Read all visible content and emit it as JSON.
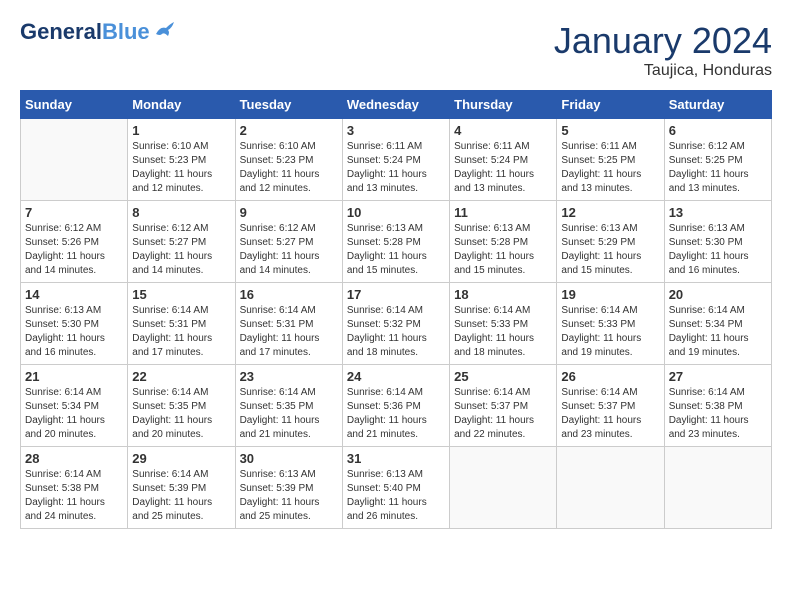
{
  "header": {
    "logo_general": "General",
    "logo_blue": "Blue",
    "month": "January 2024",
    "location": "Taujica, Honduras"
  },
  "days_of_week": [
    "Sunday",
    "Monday",
    "Tuesday",
    "Wednesday",
    "Thursday",
    "Friday",
    "Saturday"
  ],
  "weeks": [
    [
      {
        "day": "",
        "info": ""
      },
      {
        "day": "1",
        "info": "Sunrise: 6:10 AM\nSunset: 5:23 PM\nDaylight: 11 hours\nand 12 minutes."
      },
      {
        "day": "2",
        "info": "Sunrise: 6:10 AM\nSunset: 5:23 PM\nDaylight: 11 hours\nand 12 minutes."
      },
      {
        "day": "3",
        "info": "Sunrise: 6:11 AM\nSunset: 5:24 PM\nDaylight: 11 hours\nand 13 minutes."
      },
      {
        "day": "4",
        "info": "Sunrise: 6:11 AM\nSunset: 5:24 PM\nDaylight: 11 hours\nand 13 minutes."
      },
      {
        "day": "5",
        "info": "Sunrise: 6:11 AM\nSunset: 5:25 PM\nDaylight: 11 hours\nand 13 minutes."
      },
      {
        "day": "6",
        "info": "Sunrise: 6:12 AM\nSunset: 5:25 PM\nDaylight: 11 hours\nand 13 minutes."
      }
    ],
    [
      {
        "day": "7",
        "info": "Sunrise: 6:12 AM\nSunset: 5:26 PM\nDaylight: 11 hours\nand 14 minutes."
      },
      {
        "day": "8",
        "info": "Sunrise: 6:12 AM\nSunset: 5:27 PM\nDaylight: 11 hours\nand 14 minutes."
      },
      {
        "day": "9",
        "info": "Sunrise: 6:12 AM\nSunset: 5:27 PM\nDaylight: 11 hours\nand 14 minutes."
      },
      {
        "day": "10",
        "info": "Sunrise: 6:13 AM\nSunset: 5:28 PM\nDaylight: 11 hours\nand 15 minutes."
      },
      {
        "day": "11",
        "info": "Sunrise: 6:13 AM\nSunset: 5:28 PM\nDaylight: 11 hours\nand 15 minutes."
      },
      {
        "day": "12",
        "info": "Sunrise: 6:13 AM\nSunset: 5:29 PM\nDaylight: 11 hours\nand 15 minutes."
      },
      {
        "day": "13",
        "info": "Sunrise: 6:13 AM\nSunset: 5:30 PM\nDaylight: 11 hours\nand 16 minutes."
      }
    ],
    [
      {
        "day": "14",
        "info": "Sunrise: 6:13 AM\nSunset: 5:30 PM\nDaylight: 11 hours\nand 16 minutes."
      },
      {
        "day": "15",
        "info": "Sunrise: 6:14 AM\nSunset: 5:31 PM\nDaylight: 11 hours\nand 17 minutes."
      },
      {
        "day": "16",
        "info": "Sunrise: 6:14 AM\nSunset: 5:31 PM\nDaylight: 11 hours\nand 17 minutes."
      },
      {
        "day": "17",
        "info": "Sunrise: 6:14 AM\nSunset: 5:32 PM\nDaylight: 11 hours\nand 18 minutes."
      },
      {
        "day": "18",
        "info": "Sunrise: 6:14 AM\nSunset: 5:33 PM\nDaylight: 11 hours\nand 18 minutes."
      },
      {
        "day": "19",
        "info": "Sunrise: 6:14 AM\nSunset: 5:33 PM\nDaylight: 11 hours\nand 19 minutes."
      },
      {
        "day": "20",
        "info": "Sunrise: 6:14 AM\nSunset: 5:34 PM\nDaylight: 11 hours\nand 19 minutes."
      }
    ],
    [
      {
        "day": "21",
        "info": "Sunrise: 6:14 AM\nSunset: 5:34 PM\nDaylight: 11 hours\nand 20 minutes."
      },
      {
        "day": "22",
        "info": "Sunrise: 6:14 AM\nSunset: 5:35 PM\nDaylight: 11 hours\nand 20 minutes."
      },
      {
        "day": "23",
        "info": "Sunrise: 6:14 AM\nSunset: 5:35 PM\nDaylight: 11 hours\nand 21 minutes."
      },
      {
        "day": "24",
        "info": "Sunrise: 6:14 AM\nSunset: 5:36 PM\nDaylight: 11 hours\nand 21 minutes."
      },
      {
        "day": "25",
        "info": "Sunrise: 6:14 AM\nSunset: 5:37 PM\nDaylight: 11 hours\nand 22 minutes."
      },
      {
        "day": "26",
        "info": "Sunrise: 6:14 AM\nSunset: 5:37 PM\nDaylight: 11 hours\nand 23 minutes."
      },
      {
        "day": "27",
        "info": "Sunrise: 6:14 AM\nSunset: 5:38 PM\nDaylight: 11 hours\nand 23 minutes."
      }
    ],
    [
      {
        "day": "28",
        "info": "Sunrise: 6:14 AM\nSunset: 5:38 PM\nDaylight: 11 hours\nand 24 minutes."
      },
      {
        "day": "29",
        "info": "Sunrise: 6:14 AM\nSunset: 5:39 PM\nDaylight: 11 hours\nand 25 minutes."
      },
      {
        "day": "30",
        "info": "Sunrise: 6:13 AM\nSunset: 5:39 PM\nDaylight: 11 hours\nand 25 minutes."
      },
      {
        "day": "31",
        "info": "Sunrise: 6:13 AM\nSunset: 5:40 PM\nDaylight: 11 hours\nand 26 minutes."
      },
      {
        "day": "",
        "info": ""
      },
      {
        "day": "",
        "info": ""
      },
      {
        "day": "",
        "info": ""
      }
    ]
  ]
}
